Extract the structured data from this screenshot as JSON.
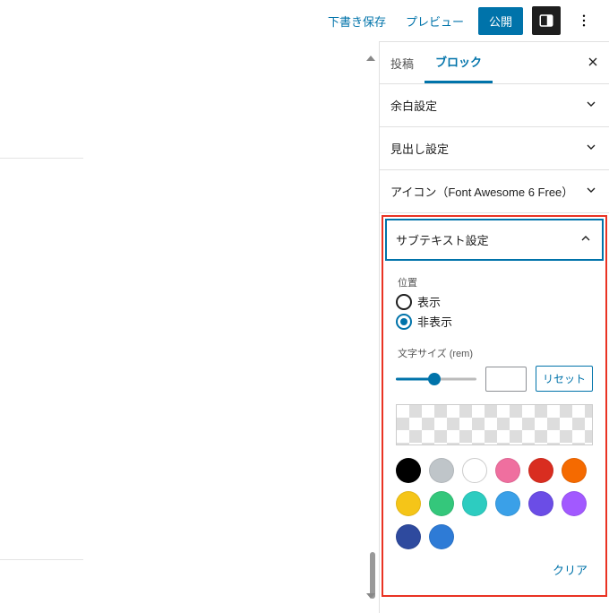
{
  "topbar": {
    "save_draft": "下書き保存",
    "preview": "プレビュー",
    "publish": "公開",
    "settings_icon": "settings-panel-icon",
    "more_icon": "more-menu-icon"
  },
  "sidebar": {
    "tabs": {
      "post": "投稿",
      "block": "ブロック"
    },
    "active_tab": "block",
    "panels": {
      "margin": {
        "title": "余白設定"
      },
      "heading": {
        "title": "見出し設定"
      },
      "icon": {
        "title": "アイコン（Font Awesome 6 Free）"
      },
      "subtext": {
        "title": "サブテキスト設定",
        "position_label": "位置",
        "options": {
          "show": "表示",
          "hide": "非表示"
        },
        "selected": "hide",
        "font_label": "文字サイズ (rem)",
        "reset": "リセット",
        "clear": "クリア",
        "swatches": [
          "#000000",
          "#bfc5c9",
          "#ffffff",
          "#ef6f9f",
          "#d92d20",
          "#f56a00",
          "#f5c518",
          "#34c77b",
          "#2dccc0",
          "#3aa0e8",
          "#6b4de6",
          "#a259ff",
          "#2e4a9e",
          "#2e7bd6"
        ]
      }
    }
  }
}
